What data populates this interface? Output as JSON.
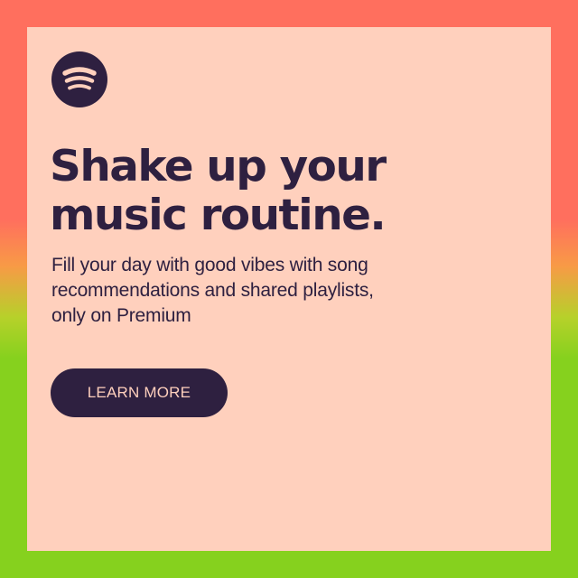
{
  "ad": {
    "headline_lines": [
      "Shake up your",
      "music routine."
    ],
    "subtext_lines": [
      "Fill your day with good vibes with song",
      "recommendations and shared playlists,",
      "only on Premium"
    ],
    "cta_label": "LEARN MORE",
    "logo_icon": "spotify-logo-icon"
  },
  "colors": {
    "card_background": "#ffd0bd",
    "ink": "#2e2040",
    "gradient_top": "#ff6f5e",
    "gradient_bottom": "#86d11e"
  }
}
